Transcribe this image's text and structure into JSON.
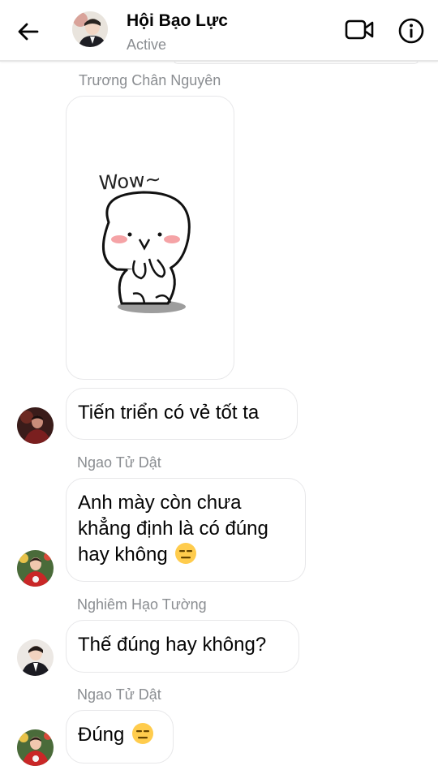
{
  "header": {
    "title": "Hội Bạo Lực",
    "status": "Active"
  },
  "messages": [
    {
      "sender": "Trương Chân Nguyên",
      "type": "sticker",
      "sticker_text": "Wow~"
    },
    {
      "sender": "",
      "text": "Tiến triển có vẻ tốt ta",
      "avatar": "avatar-dark-red"
    },
    {
      "sender": "Ngao Tử Dật",
      "text_lines": [
        "Anh mày còn chưa",
        "khẳng định là có đúng",
        "hay không"
      ],
      "emoji": "expressionless-face",
      "avatar": "avatar-red-sweater"
    },
    {
      "sender": "Nghiêm Hạo Tường",
      "text": "Thế đúng hay không?",
      "avatar": "avatar-suit"
    },
    {
      "sender": "Ngao Tử Dật",
      "text": "Đúng",
      "emoji": "expressionless-face",
      "avatar": "avatar-red-sweater"
    }
  ],
  "colors": {
    "text_primary": "#050505",
    "text_secondary": "#8a8d91",
    "bubble_border": "#e7e7e9",
    "emoji_yellow": "#ffcc4d"
  },
  "icons": [
    "back-arrow-icon",
    "video-camera-icon",
    "info-icon",
    "expressionless-face-emoji"
  ]
}
